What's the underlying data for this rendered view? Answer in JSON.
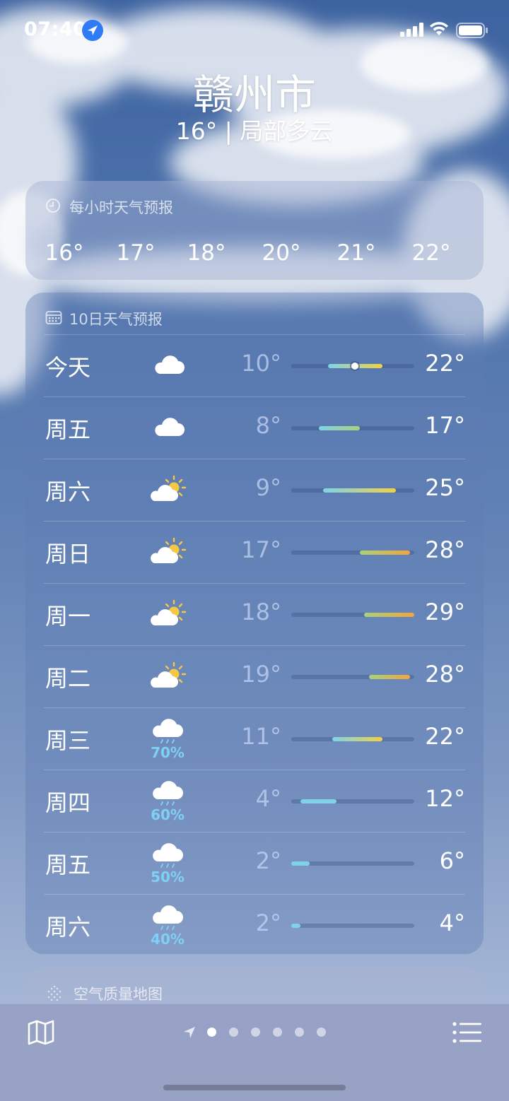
{
  "status_bar": {
    "time": "07:40"
  },
  "header": {
    "city": "赣州市",
    "condition": "16° | 局部多云"
  },
  "hourly": {
    "title": "每小时天气预报",
    "temps": [
      "16°",
      "17°",
      "18°",
      "20°",
      "21°",
      "22°"
    ]
  },
  "daily": {
    "title": "10日天气预报",
    "range_min": 2,
    "range_max": 29,
    "days": [
      {
        "name": "今天",
        "icon": "cloud-icon",
        "lo": "10°",
        "hi": "22°",
        "lo_v": 10,
        "hi_v": 22,
        "current_v": 16,
        "pop": ""
      },
      {
        "name": "周五",
        "icon": "cloud-icon",
        "lo": "8°",
        "hi": "17°",
        "lo_v": 8,
        "hi_v": 17,
        "pop": ""
      },
      {
        "name": "周六",
        "icon": "partly-sunny-icon",
        "lo": "9°",
        "hi": "25°",
        "lo_v": 9,
        "hi_v": 25,
        "pop": ""
      },
      {
        "name": "周日",
        "icon": "partly-sunny-icon",
        "lo": "17°",
        "hi": "28°",
        "lo_v": 17,
        "hi_v": 28,
        "pop": ""
      },
      {
        "name": "周一",
        "icon": "partly-sunny-icon",
        "lo": "18°",
        "hi": "29°",
        "lo_v": 18,
        "hi_v": 29,
        "pop": ""
      },
      {
        "name": "周二",
        "icon": "partly-sunny-icon",
        "lo": "19°",
        "hi": "28°",
        "lo_v": 19,
        "hi_v": 28,
        "pop": ""
      },
      {
        "name": "周三",
        "icon": "rain-icon",
        "lo": "11°",
        "hi": "22°",
        "lo_v": 11,
        "hi_v": 22,
        "pop": "70%"
      },
      {
        "name": "周四",
        "icon": "rain-icon",
        "lo": "4°",
        "hi": "12°",
        "lo_v": 4,
        "hi_v": 12,
        "pop": "60%"
      },
      {
        "name": "周五",
        "icon": "rain-icon",
        "lo": "2°",
        "hi": "6°",
        "lo_v": 2,
        "hi_v": 6,
        "pop": "50%"
      },
      {
        "name": "周六",
        "icon": "rain-icon",
        "lo": "2°",
        "hi": "4°",
        "lo_v": 2,
        "hi_v": 4,
        "pop": "40%"
      }
    ]
  },
  "air_quality": {
    "title": "空气质量地图"
  },
  "tabbar": {
    "page_count": 6,
    "active_page": 0
  },
  "colors": {
    "cool": "#7fd3e8",
    "mild": "#a8d27a",
    "warm": "#f2d13f",
    "hot": "#f2a43e",
    "location_blue": "#2f7bf5"
  }
}
